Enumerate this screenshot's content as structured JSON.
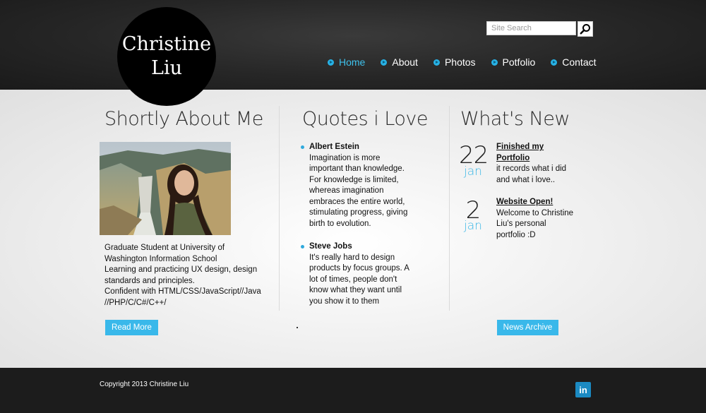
{
  "site": {
    "logo_line1": "Christine",
    "logo_line2": "Liu"
  },
  "search": {
    "placeholder": "Site Search",
    "icon": "magnifier-icon"
  },
  "nav": {
    "items": [
      {
        "label": "Home",
        "active": true
      },
      {
        "label": "About",
        "active": false
      },
      {
        "label": "Photos",
        "active": false
      },
      {
        "label": "Potfolio",
        "active": false
      },
      {
        "label": "Contact",
        "active": false
      }
    ]
  },
  "about": {
    "heading": "Shortly About Me",
    "photo_icon": "portrait-photo",
    "lines": [
      "Graduate Student at University of Washington Information School",
      "Learning and practicing UX design, design standards and principles.",
      "Confident with HTML/CSS/JavaScript//Java //PHP/C/C#/C++/"
    ],
    "button": "Read More"
  },
  "quotes": {
    "heading": "Quotes i Love",
    "items": [
      {
        "author": "Albert Estein",
        "text": "Imagination is more important than knowledge. For knowledge is limited, whereas imagination embraces the entire world, stimulating progress, giving birth to evolution."
      },
      {
        "author": "Steve Jobs",
        "text": "It's really hard to design products by focus groups. A lot of times, people don't know what they want until you show it to them"
      }
    ]
  },
  "news": {
    "heading": "What's New",
    "items": [
      {
        "day": "22",
        "month": "jan",
        "title": "Finished my Portfolio",
        "text": "it records what i did and what i love.."
      },
      {
        "day": "2",
        "month": "jan",
        "title": "Website Open!",
        "text": "Welcome to Christine Liu's personal portfolio :D"
      }
    ],
    "button": "News Archive"
  },
  "footer": {
    "copyright": "Copyright 2013 Christine Liu",
    "linkedin_label": "in"
  },
  "colors": {
    "accent": "#39b8ea",
    "header_bg": "#262626",
    "footer_bg": "#1c1c1c"
  }
}
